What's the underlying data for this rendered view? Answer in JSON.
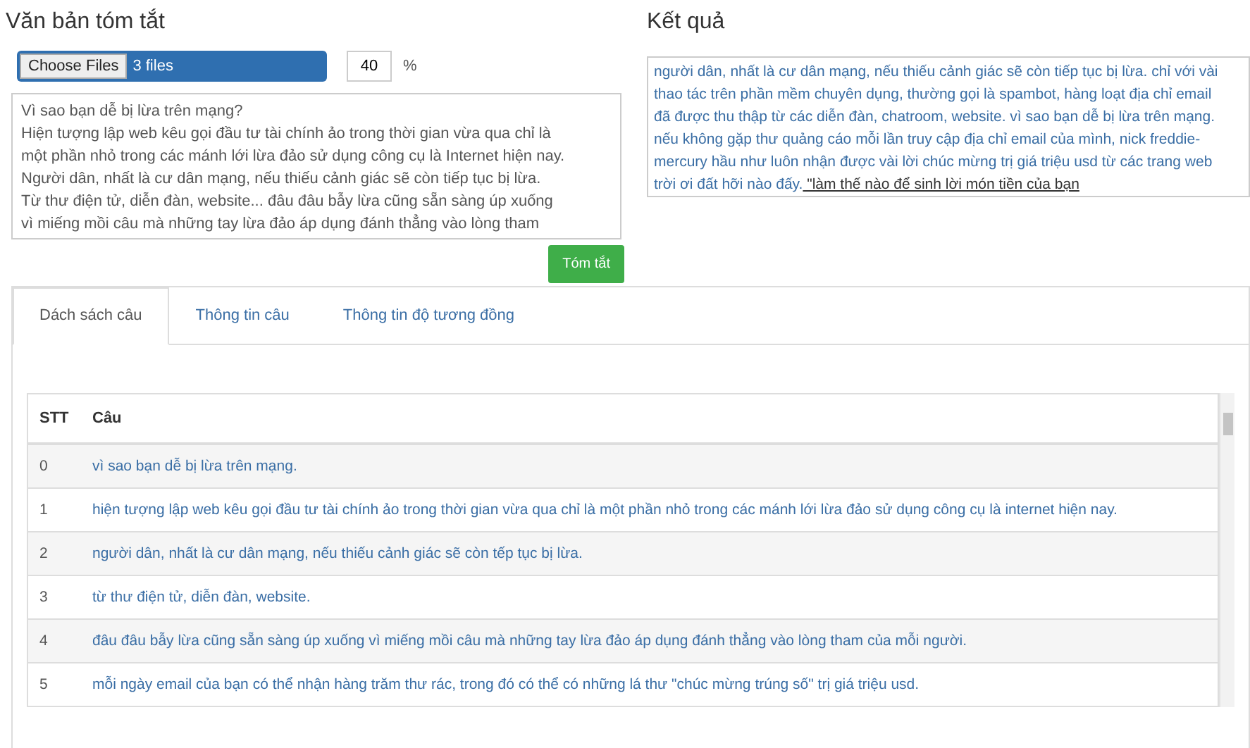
{
  "input_panel": {
    "title": "Văn bản tóm tắt",
    "file_button": "Choose Files",
    "file_status": "3 files",
    "ratio": "40",
    "ratio_unit": "%",
    "text_lines": [
      "Vì sao bạn dễ bị lừa trên mạng?",
      "Hiện tượng lập web kêu gọi đầu tư tài chính ảo trong thời gian vừa qua chỉ là",
      "một phần nhỏ trong các mánh lới lừa đảo sử dụng công cụ là Internet hiện nay.",
      "Người dân, nhất là cư dân mạng, nếu thiếu cảnh giác sẽ còn tiếp tục bị lừa.",
      "Từ thư điện tử, diễn đàn, website... đâu đâu bẫy lừa cũng sẵn sàng úp xuống",
      "vì miếng mồi câu mà những tay lừa đảo áp dụng đánh thẳng vào lòng tham"
    ],
    "submit": "Tóm tắt"
  },
  "result_panel": {
    "title": "Kết quả",
    "segments": [
      {
        "text": "người dân, nhất là cư dân mạng, nếu thiếu cảnh giác sẽ còn tiếp tục bị lừa. chỉ với vài thao tác trên phần mềm chuyên dụng, thường gọi là spambot, hàng loạt địa chỉ email đã được thu thập từ các diễn đàn, chatroom, website. vì sao bạn dễ bị lừa trên mạng. nếu không gặp thư quảng cáo mỗi lần truy cập địa chỉ email của mình, nick freddie-mercury hầu như luôn nhận được vài lời chúc mừng trị giá triệu usd từ các trang web trời ơi đất hỡi nào đấy.",
        "underlined": false
      },
      {
        "text": "\"làm thế nào để sinh lời món tiền của bạn",
        "underlined": true
      }
    ]
  },
  "tabs": [
    {
      "label": "Dách sách câu",
      "selected": true
    },
    {
      "label": "Thông tin câu",
      "selected": false
    },
    {
      "label": "Thông tin độ tương đồng",
      "selected": false
    }
  ],
  "table": {
    "columns": [
      "STT",
      "Câu"
    ],
    "rows": [
      {
        "stt": "0",
        "sentence": "vì sao bạn dễ bị lừa trên mạng."
      },
      {
        "stt": "1",
        "sentence": "hiện tượng lập web kêu gọi đầu tư tài chính ảo trong thời gian vừa qua chỉ là một phần nhỏ trong các mánh lới lừa đảo sử dụng công cụ là internet hiện nay."
      },
      {
        "stt": "2",
        "sentence": "người dân, nhất là cư dân mạng, nếu thiếu cảnh giác sẽ còn tếp tục bị lừa."
      },
      {
        "stt": "3",
        "sentence": "từ thư điện tử, diễn đàn, website."
      },
      {
        "stt": "4",
        "sentence": "đâu đâu bẫy lừa cũng sẵn sàng úp xuống vì miếng mồi câu mà những tay lừa đảo áp dụng đánh thẳng vào lòng tham của mỗi người."
      },
      {
        "stt": "5",
        "sentence": "mỗi ngày email của bạn có thể nhận hàng trăm thư rác, trong đó có thể có những lá thư \"chúc mừng trúng số\" trị giá triệu usd."
      }
    ]
  }
}
